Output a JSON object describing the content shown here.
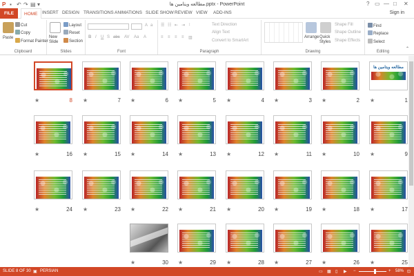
{
  "window": {
    "title": "مطالعه ویتامین ها.pptx - PowerPoint",
    "controls": [
      "?",
      "▭",
      "—",
      "□",
      "✕"
    ]
  },
  "tabs": {
    "file": "FILE",
    "items": [
      "HOME",
      "INSERT",
      "DESIGN",
      "TRANSITIONS",
      "ANIMATIONS",
      "SLIDE SHOW",
      "REVIEW",
      "VIEW",
      "ADD-INS"
    ],
    "active": "HOME",
    "signin": "Sign in"
  },
  "ribbon": {
    "clipboard": {
      "label": "Clipboard",
      "paste": "Paste",
      "cut": "Cut",
      "copy": "Copy",
      "format_painter": "Format Painter"
    },
    "slides": {
      "label": "Slides",
      "new_slide": "New Slide",
      "layout": "Layout",
      "reset": "Reset",
      "section": "Section"
    },
    "font": {
      "label": "Font"
    },
    "paragraph": {
      "label": "Paragraph",
      "text_direction": "Text Direction",
      "align_text": "Align Text",
      "smartart": "Convert to SmartArt"
    },
    "drawing": {
      "label": "Drawing",
      "arrange": "Arrange",
      "quick_styles": "Quick Styles",
      "shape_fill": "Shape Fill",
      "shape_outline": "Shape Outline",
      "shape_effects": "Shape Effects"
    },
    "editing": {
      "label": "Editing",
      "find": "Find",
      "replace": "Replace",
      "select": "Select"
    }
  },
  "title_slide_text": "مطالعه ویتامین ها",
  "slides": [
    {
      "number": "1",
      "kind": "title"
    },
    {
      "number": "2",
      "kind": "content"
    },
    {
      "number": "3",
      "kind": "content"
    },
    {
      "number": "4",
      "kind": "content"
    },
    {
      "number": "5",
      "kind": "content"
    },
    {
      "number": "6",
      "kind": "content"
    },
    {
      "number": "7",
      "kind": "content"
    },
    {
      "number": "8",
      "kind": "content",
      "selected": true
    },
    {
      "number": "9",
      "kind": "content"
    },
    {
      "number": "10",
      "kind": "content"
    },
    {
      "number": "11",
      "kind": "content"
    },
    {
      "number": "12",
      "kind": "content"
    },
    {
      "number": "13",
      "kind": "content"
    },
    {
      "number": "14",
      "kind": "content"
    },
    {
      "number": "15",
      "kind": "content"
    },
    {
      "number": "16",
      "kind": "content"
    },
    {
      "number": "17",
      "kind": "content"
    },
    {
      "number": "18",
      "kind": "content"
    },
    {
      "number": "19",
      "kind": "content"
    },
    {
      "number": "20",
      "kind": "content"
    },
    {
      "number": "21",
      "kind": "content"
    },
    {
      "number": "22",
      "kind": "content"
    },
    {
      "number": "23",
      "kind": "content"
    },
    {
      "number": "24",
      "kind": "content"
    },
    {
      "number": "25",
      "kind": "content"
    },
    {
      "number": "26",
      "kind": "content"
    },
    {
      "number": "27",
      "kind": "content"
    },
    {
      "number": "28",
      "kind": "content"
    },
    {
      "number": "29",
      "kind": "content"
    },
    {
      "number": "30",
      "kind": "photo"
    }
  ],
  "status": {
    "slide_info": "SLIDE 8 OF 30",
    "language": "PERSIAN",
    "zoom_level": "58%",
    "zoom_fraction": 0.58
  }
}
